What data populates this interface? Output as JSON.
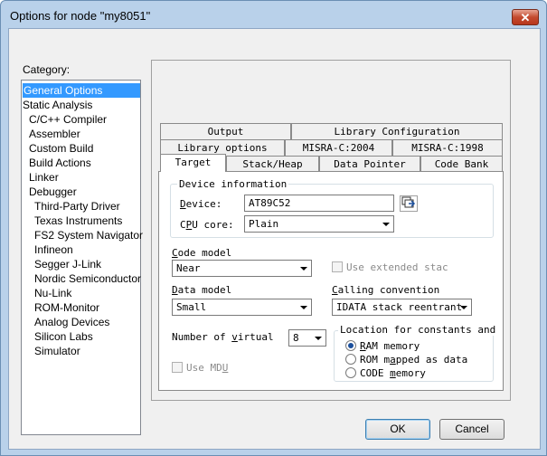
{
  "window": {
    "title": "Options for node \"my8051\"",
    "close_label": "✕"
  },
  "category": {
    "label": "Category:",
    "items": [
      {
        "label": "General Options",
        "indent": 0,
        "selected": true
      },
      {
        "label": "Static Analysis",
        "indent": 0
      },
      {
        "label": "C/C++ Compiler",
        "indent": 1
      },
      {
        "label": "Assembler",
        "indent": 1
      },
      {
        "label": "Custom Build",
        "indent": 1
      },
      {
        "label": "Build Actions",
        "indent": 1
      },
      {
        "label": "Linker",
        "indent": 1
      },
      {
        "label": "Debugger",
        "indent": 1
      },
      {
        "label": "Third-Party Driver",
        "indent": 2
      },
      {
        "label": "Texas Instruments",
        "indent": 2
      },
      {
        "label": "FS2 System Navigator",
        "indent": 2
      },
      {
        "label": "Infineon",
        "indent": 2
      },
      {
        "label": "Segger J-Link",
        "indent": 2
      },
      {
        "label": "Nordic Semiconductor",
        "indent": 2
      },
      {
        "label": "Nu-Link",
        "indent": 2
      },
      {
        "label": "ROM-Monitor",
        "indent": 2
      },
      {
        "label": "Analog Devices",
        "indent": 2
      },
      {
        "label": "Silicon Labs",
        "indent": 2
      },
      {
        "label": "Simulator",
        "indent": 2
      }
    ]
  },
  "tabs": {
    "row1": [
      "Output",
      "Library Configuration"
    ],
    "row2": [
      "Library options",
      "MISRA-C:2004",
      "MISRA-C:1998"
    ],
    "row3": [
      "Target",
      "Stack/Heap",
      "Data Pointer",
      "Code Bank"
    ],
    "active": "Target"
  },
  "target": {
    "device_info_title": "Device information",
    "device_label": "Device:",
    "device_value": "AT89C52",
    "cpu_core_label": "CPU core:",
    "cpu_core_value": "Plain",
    "code_model_label": "Code model",
    "code_model_value": "Near",
    "use_extended_stack_label": "Use extended stac",
    "data_model_label": "Data model",
    "data_model_value": "Small",
    "calling_convention_label": "Calling convention",
    "calling_convention_value": "IDATA stack reentrant",
    "num_virtual_label": "Number of virtual",
    "num_virtual_value": "8",
    "location_title": "Location for constants and str",
    "location_options": [
      "RAM memory",
      "ROM mapped as data",
      "CODE memory"
    ],
    "location_selected": "RAM memory",
    "use_mdu_label": "Use MDU"
  },
  "buttons": {
    "ok": "OK",
    "cancel": "Cancel"
  }
}
